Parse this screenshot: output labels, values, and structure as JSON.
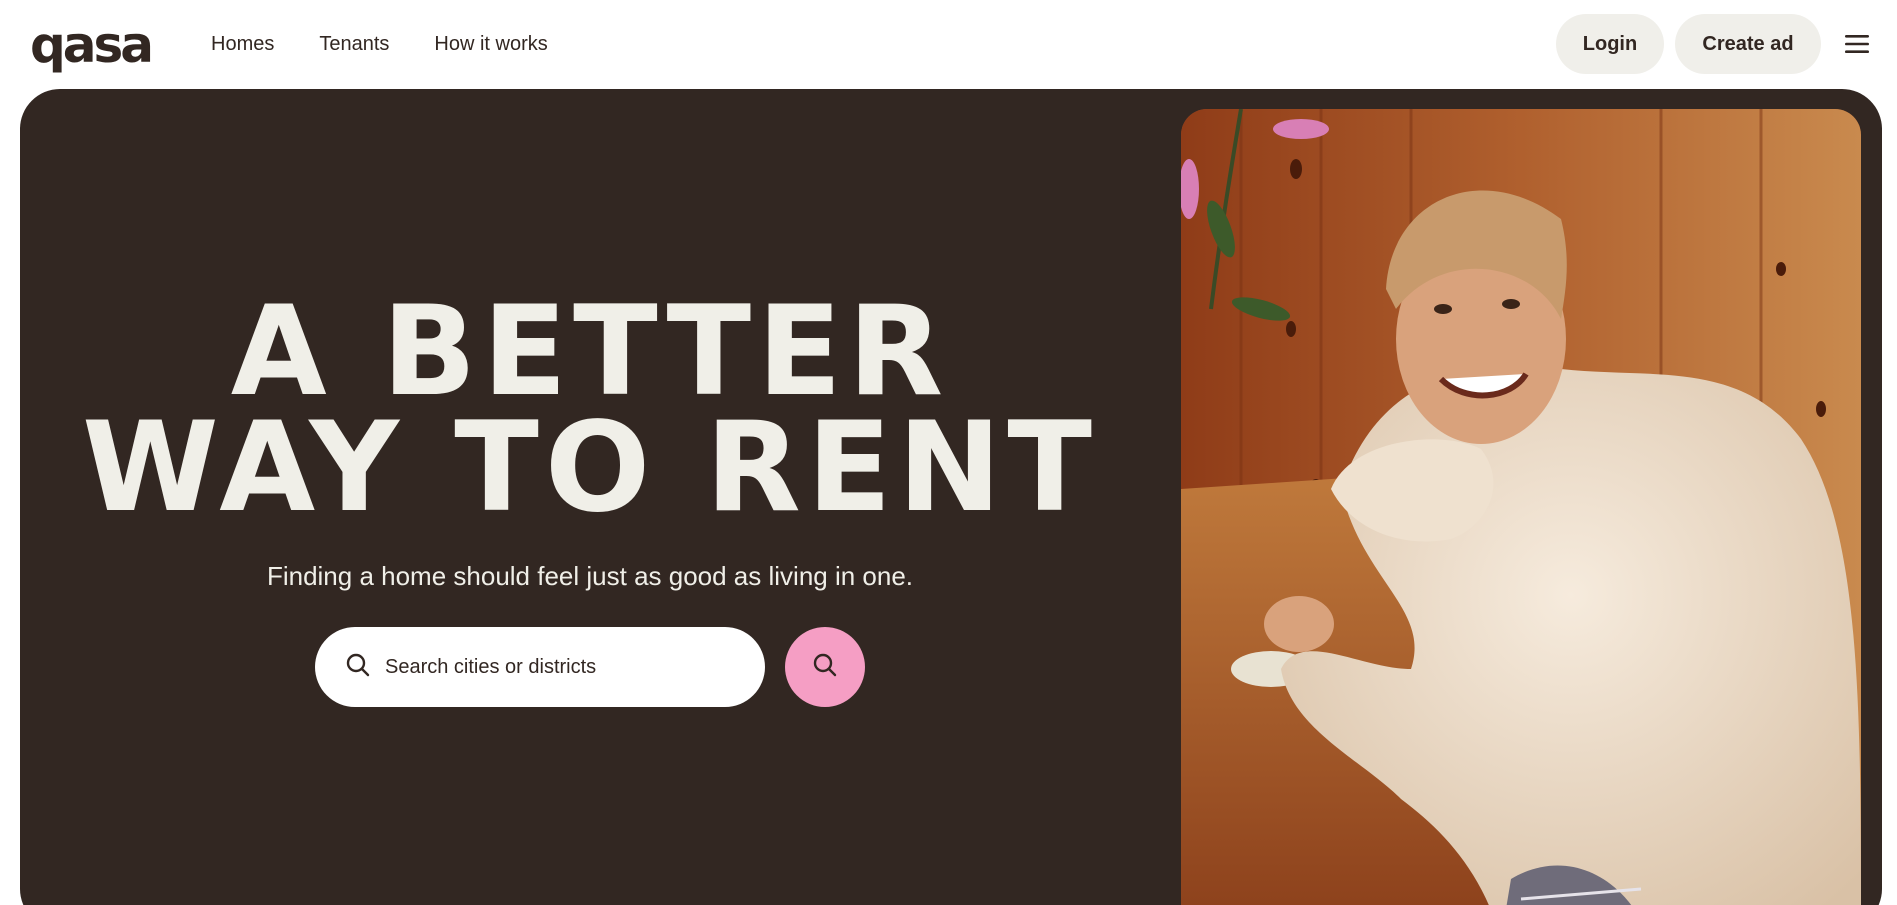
{
  "brand": {
    "logo_text": "qasa"
  },
  "nav": {
    "links": [
      {
        "label": "Homes"
      },
      {
        "label": "Tenants"
      },
      {
        "label": "How it works"
      }
    ]
  },
  "header": {
    "login_label": "Login",
    "create_ad_label": "Create ad",
    "menu_icon": "hamburger-menu-icon"
  },
  "hero": {
    "headline_line1": "A BETTER",
    "headline_line2": "WAY TO RENT",
    "subtitle": "Finding a home should feel just as good as living in one.",
    "search": {
      "placeholder": "Search cities or districts",
      "value": "",
      "icon": "search-icon",
      "button_icon": "search-icon"
    },
    "image_icon": "photo-woman-smiling-at-table"
  },
  "colors": {
    "hero_bg": "#322722",
    "text_dark": "#322722",
    "text_light": "#f0efe8",
    "pill_bg": "#f0efea",
    "search_button": "#f59ec4"
  }
}
